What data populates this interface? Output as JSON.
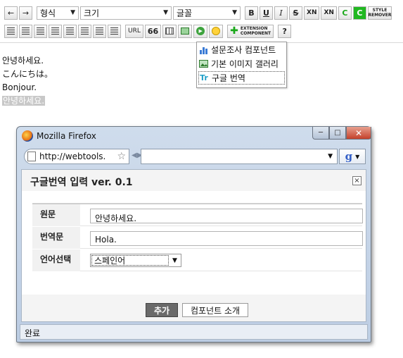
{
  "editor": {
    "toolbar": {
      "back_icon": "arrow-left",
      "forward_icon": "arrow-right",
      "format_select": "형식",
      "size_select": "크기",
      "font_select": "글꼴",
      "bold": "B",
      "underline": "U",
      "italic": "I",
      "strike": "S",
      "superscript": "XN",
      "subscript": "XN",
      "color_text": "C",
      "bgcolor_text": "C",
      "style_remover": "STYLE REMOVER",
      "url_label": "URL",
      "quote_label": "66",
      "extension_label": "EXTENSION COMPONENT",
      "help_label": "?"
    },
    "dropdown": {
      "items": [
        {
          "label": "설문조사 컴포넌트",
          "icon": "chart-icon"
        },
        {
          "label": "기본 이미지 갤러리",
          "icon": "image-gallery-icon"
        },
        {
          "label": "구글 번역",
          "icon": "translate-icon"
        }
      ]
    },
    "content_lines": [
      "안녕하세요.",
      "こんにちは。",
      "Bonjour.",
      "안녕하세요."
    ]
  },
  "firefox": {
    "title": "Mozilla Firefox",
    "url": "http://webtools.",
    "search_engine": "g",
    "status": "완료"
  },
  "dialog": {
    "title": "구글번역 입력 ver. 0.1",
    "close": "×",
    "rows": {
      "source_label": "원문",
      "source_value": "안녕하세요.",
      "translation_label": "번역문",
      "translation_value": "Hola.",
      "language_label": "언어선택",
      "language_value": "스페인어"
    },
    "add_button": "추가",
    "intro_button": "컴포넌트 소개"
  },
  "colors": {
    "accent_green": "#21b821",
    "dialog_button_dark": "#6a6a6a",
    "firefox_close_red": "#c4412a"
  }
}
